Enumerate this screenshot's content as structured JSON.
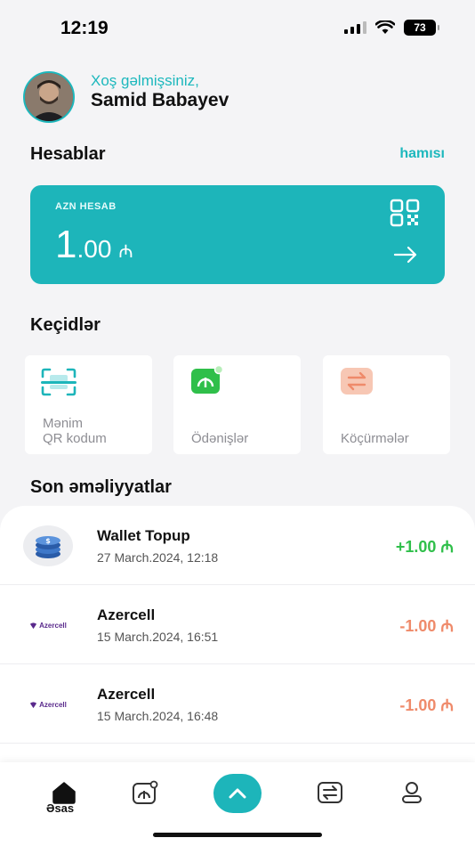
{
  "status_bar": {
    "time": "12:19",
    "battery": "73"
  },
  "header": {
    "greeting": "Xoş gəlmişsiniz,",
    "user_name": "Samid Babayev"
  },
  "accounts": {
    "title": "Hesablar",
    "see_all": "hamısı",
    "card": {
      "label": "AZN HESAB",
      "amount_int": "1",
      "amount_dec": ".00",
      "currency": "₼"
    }
  },
  "shortcuts": {
    "title": "Keçidlər",
    "items": [
      {
        "label_line1": "Mənim",
        "label_line2": "QR kodum",
        "icon": "qr-scan-icon"
      },
      {
        "label_line1": "",
        "label_line2": "Ödənişlər",
        "icon": "payment-icon"
      },
      {
        "label_line1": "",
        "label_line2": "Köçürmələr",
        "icon": "transfer-icon"
      }
    ]
  },
  "transactions": {
    "title": "Son əməliyyatlar",
    "items": [
      {
        "title": "Wallet Topup",
        "date": "27 March.2024, 12:18",
        "amount": "+1.00 ₼",
        "type": "credit",
        "logo": "coins-icon"
      },
      {
        "title": "Azercell",
        "date": "15 March.2024, 16:51",
        "amount": "-1.00 ₼",
        "type": "debit",
        "logo": "Azercell"
      },
      {
        "title": "Azercell",
        "date": "15 March.2024, 16:48",
        "amount": "-1.00 ₼",
        "type": "debit",
        "logo": "Azercell"
      }
    ]
  },
  "nav": {
    "home_label": "Əsas"
  },
  "colors": {
    "accent": "#1db5ba",
    "positive": "#2fbf4a",
    "negative": "#ef8a6a"
  }
}
